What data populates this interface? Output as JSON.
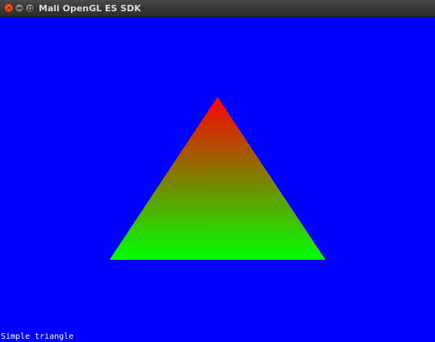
{
  "window": {
    "title": "Mali OpenGL ES SDK",
    "controls": {
      "close_icon": "close-icon",
      "minimize_icon": "minimize-icon",
      "maximize_icon": "maximize-icon"
    }
  },
  "scene": {
    "clear_color": "#0000ff",
    "triangle": {
      "vertex_colors": {
        "top": "#ff0000",
        "bottom_left": "#00ff00",
        "bottom_right": "#00ff00"
      }
    },
    "overlay_text": "Simple triangle"
  }
}
